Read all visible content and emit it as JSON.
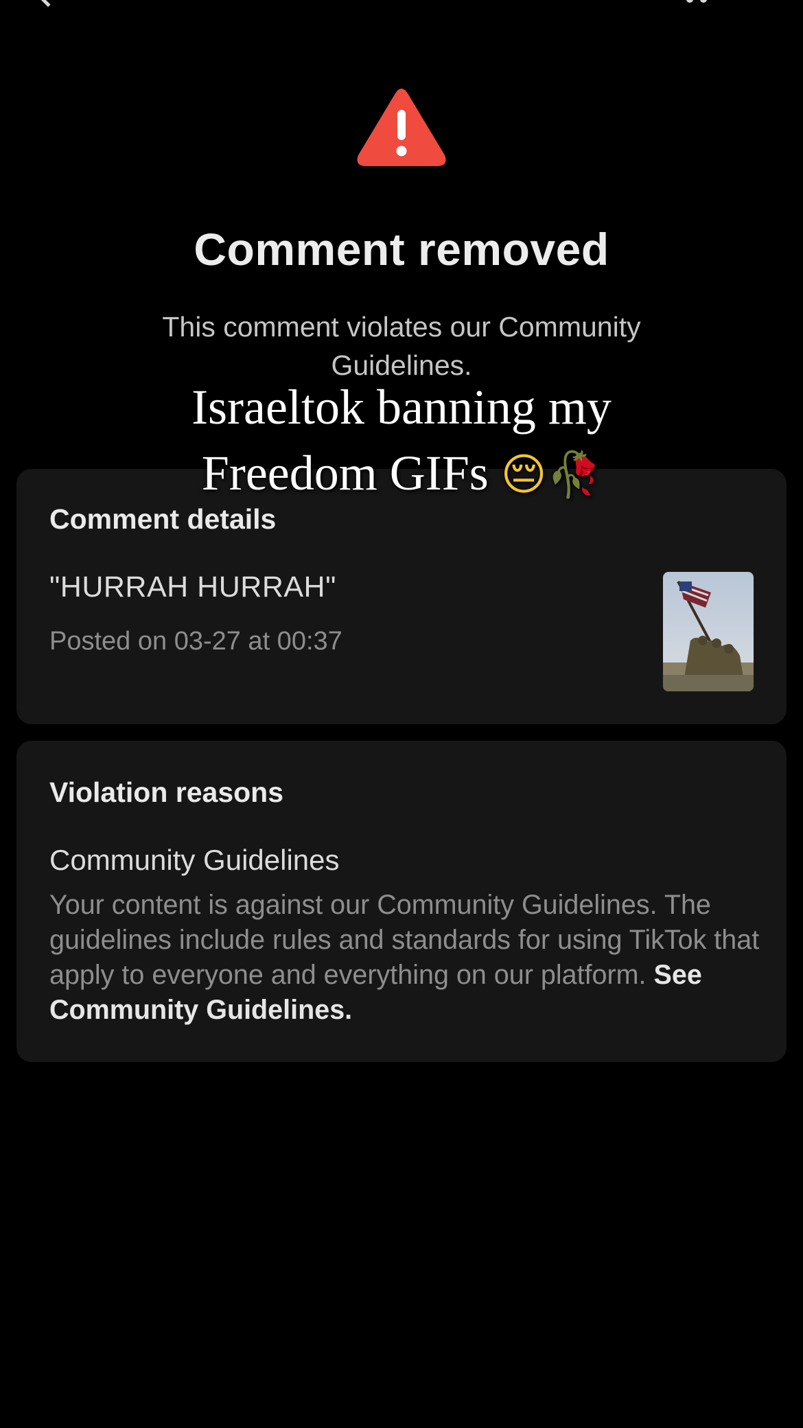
{
  "header": {
    "back_icon": "chevron-left-icon",
    "more_icon": "more-dots-icon"
  },
  "alert": {
    "icon": "warning-triangle-icon",
    "icon_color": "#f04b3f",
    "title": "Comment removed",
    "subtitle": "This comment violates our Community Guidelines."
  },
  "comment_details": {
    "heading": "Comment details",
    "comment": "\"HURRAH HURRAH\"",
    "posted": "Posted on 03-27 at 00:37",
    "thumbnail_icon": "video-thumbnail"
  },
  "violation": {
    "heading": "Violation reasons",
    "reason_title": "Community Guidelines",
    "reason_body": "Your content is against our Community Guidelines. The guidelines include rules and standards for using TikTok that apply to everyone and everything on our platform.",
    "reason_link": "See Community Guidelines."
  },
  "overlay_caption": {
    "line1": "Israeltok banning my",
    "line2": "Freedom GIFs",
    "emoji1": "😔",
    "emoji2": "🥀"
  },
  "colors": {
    "background": "#000000",
    "card": "#161616",
    "accent_warning": "#f04b3f"
  }
}
